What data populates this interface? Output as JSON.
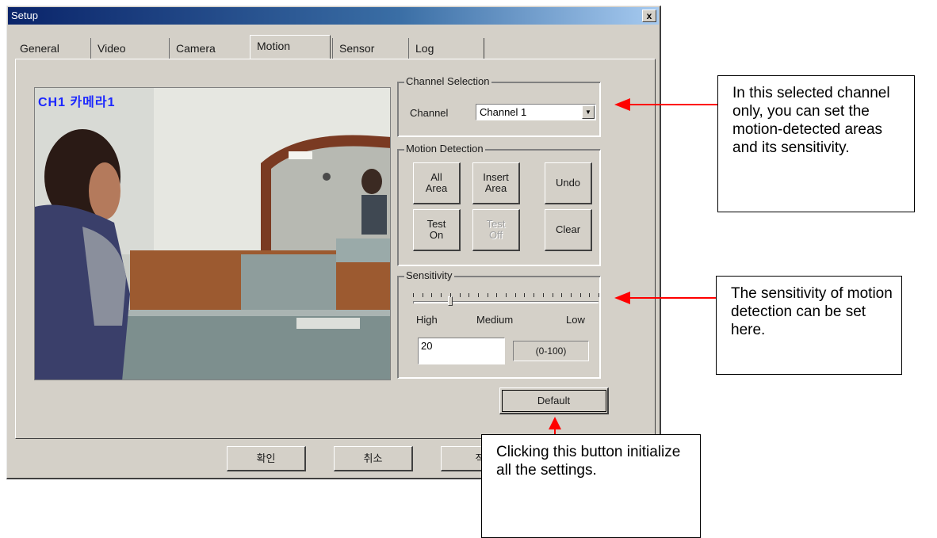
{
  "window": {
    "title": "Setup",
    "close_label": "x"
  },
  "tabs": [
    {
      "label": "General"
    },
    {
      "label": "Video"
    },
    {
      "label": "Camera"
    },
    {
      "label": "Motion",
      "active": true
    },
    {
      "label": "Sensor"
    },
    {
      "label": "Log"
    }
  ],
  "preview": {
    "overlay_text": "CH1 카메라1"
  },
  "channel_selection": {
    "title": "Channel Selection",
    "channel_label": "Channel",
    "selected_value": "Channel 1"
  },
  "motion_detection": {
    "title": "Motion Detection",
    "buttons": {
      "all_area": "All\nArea",
      "insert_area": "Insert\nArea",
      "undo": "Undo",
      "test_on": "Test\nOn",
      "test_off": "Test\nOff",
      "clear": "Clear"
    }
  },
  "sensitivity": {
    "title": "Sensitivity",
    "high_label": "High",
    "medium_label": "Medium",
    "low_label": "Low",
    "value": "20",
    "range_label": "(0-100)",
    "slider_value": 20
  },
  "default_button": "Default",
  "bottom_buttons": {
    "ok": "확인",
    "cancel": "취소",
    "apply": "적"
  },
  "callouts": {
    "channel": "In this selected channel only, you can set the motion-detected areas and its sensitivity.",
    "sensitivity": "The sensitivity of motion detection can be set here.",
    "default": "Clicking this button initialize all the settings."
  },
  "colors": {
    "titlebar_start": "#0a246a",
    "dialog_face": "#d4d0c8",
    "overlay_text": "#1b27ff",
    "arrow": "#ff0000"
  }
}
